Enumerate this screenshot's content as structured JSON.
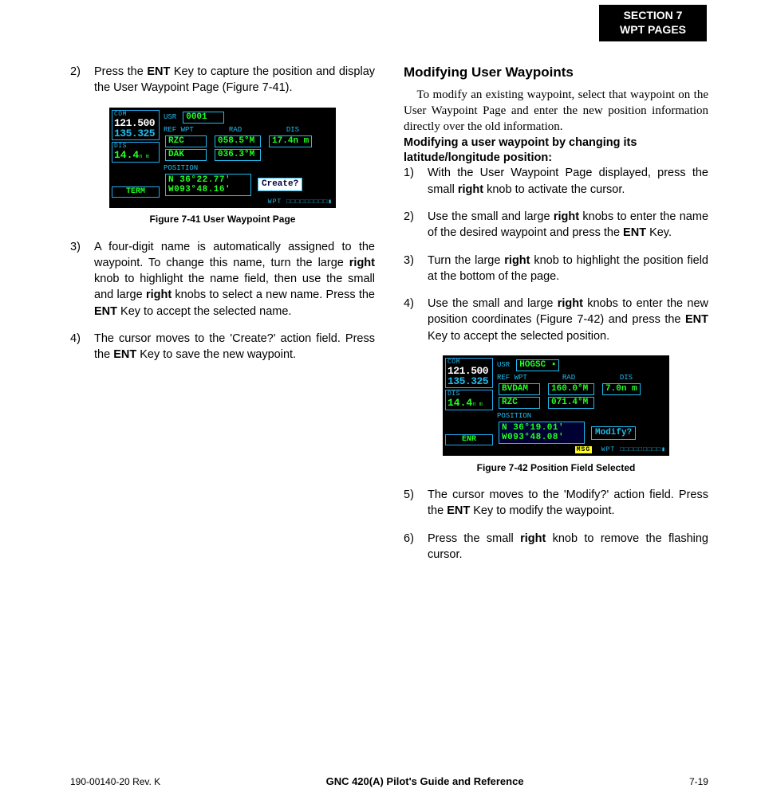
{
  "section_tab": {
    "line1": "SECTION 7",
    "line2": "WPT PAGES"
  },
  "left": {
    "step2": {
      "num": "2)",
      "text_pre": "Press the ",
      "k1": "ENT",
      "text_mid": " Key to capture the position and display the User Waypoint Page (Figure 7-41)."
    },
    "fig41_caption": "Figure 7-41  User Waypoint Page",
    "step3": {
      "num": "3)",
      "t1": "A four-digit name is automatically assigned to the waypoint.  To change this name, turn the large ",
      "k1": "right",
      "t2": " knob to highlight the name field, then use the small and large ",
      "k2": "right",
      "t3": " knobs to select a new name.  Press the ",
      "k3": "ENT",
      "t4": " Key to accept the selected name."
    },
    "step4": {
      "num": "4)",
      "t1": "The cursor moves to the 'Create?' action field.  Press the ",
      "k1": "ENT",
      "t2": " Key to save the new waypoint."
    }
  },
  "right": {
    "heading": "Modifying User Waypoints",
    "intro": "To modify an existing waypoint, select that waypoint on the User Waypoint Page and enter the new position information directly over the old information.",
    "procedure_title": "Modifying a user waypoint by changing its latitude/longitude position:",
    "step1": {
      "num": "1)",
      "t1": "With the User Waypoint Page displayed, press the small ",
      "k1": "right",
      "t2": " knob to activate the cursor."
    },
    "step2": {
      "num": "2)",
      "t1": "Use the small and large ",
      "k1": "right",
      "t2": " knobs to enter the name of the desired waypoint and press the ",
      "k2": "ENT",
      "t3": " Key."
    },
    "step3": {
      "num": "3)",
      "t1": "Turn the large ",
      "k1": "right",
      "t2": " knob to highlight the position field at the bottom of the page."
    },
    "step4": {
      "num": "4)",
      "t1": "Use the small and large ",
      "k1": "right",
      "t2": " knobs to enter the new position coordinates (Figure 7-42) and press the ",
      "k2": "ENT",
      "t3": " Key to accept the selected position."
    },
    "fig42_caption": "Figure 7-42  Position Field Selected",
    "step5": {
      "num": "5)",
      "t1": "The cursor moves to the 'Modify?' action field.  Press the ",
      "k1": "ENT",
      "t2": " Key to modify the waypoint."
    },
    "step6": {
      "num": "6)",
      "t1": "Press the small ",
      "k1": "right",
      "t2": " knob to remove the flashing cursor."
    }
  },
  "fig41": {
    "com_lbl": "COM",
    "com_active": "121.500",
    "com_standby": "135.325",
    "dis_lbl": "DIS",
    "dis_val": "14.4",
    "dis_unit": "n m",
    "mode": "TERM",
    "usr_lbl": "USR",
    "usr_val": "0001",
    "hdr_ref": "REF WPT",
    "hdr_rad": "RAD",
    "hdr_dis": "DIS",
    "row1_ref": "RZC",
    "row1_rad": "058.5°M",
    "row1_dis": "17.4n m",
    "row2_ref": "DAK",
    "row2_rad": "036.3°M",
    "pos_lbl": "POSITION",
    "pos_lat": "N 36°22.77'",
    "pos_lon": "W093°48.16'",
    "action": "Create?",
    "footer": "WPT  □□□□□□□□□▮"
  },
  "fig42": {
    "com_lbl": "COM",
    "com_active": "121.500",
    "com_standby": "135.325",
    "dis_lbl": "DIS",
    "dis_val": "14.4",
    "dis_unit": "n m",
    "mode": "ENR",
    "usr_lbl": "USR",
    "usr_val": "HOGSC ▪",
    "hdr_ref": "REF WPT",
    "hdr_rad": "RAD",
    "hdr_dis": "DIS",
    "row1_ref": "BVDAM",
    "row1_rad": "160.0°M",
    "row1_dis": "7.0n m",
    "row2_ref": "RZC",
    "row2_rad": "071.4°M",
    "pos_lbl": "POSITION",
    "pos_lat": "N 36°19.01'",
    "pos_lon": "W093°48.08'",
    "action": "Modify?",
    "msg": "MSG",
    "footer": "WPT  □□□□□□□□□▮"
  },
  "footer": {
    "left": "190-00140-20  Rev. K",
    "center": "GNC 420(A) Pilot's Guide and Reference",
    "right": "7-19"
  }
}
